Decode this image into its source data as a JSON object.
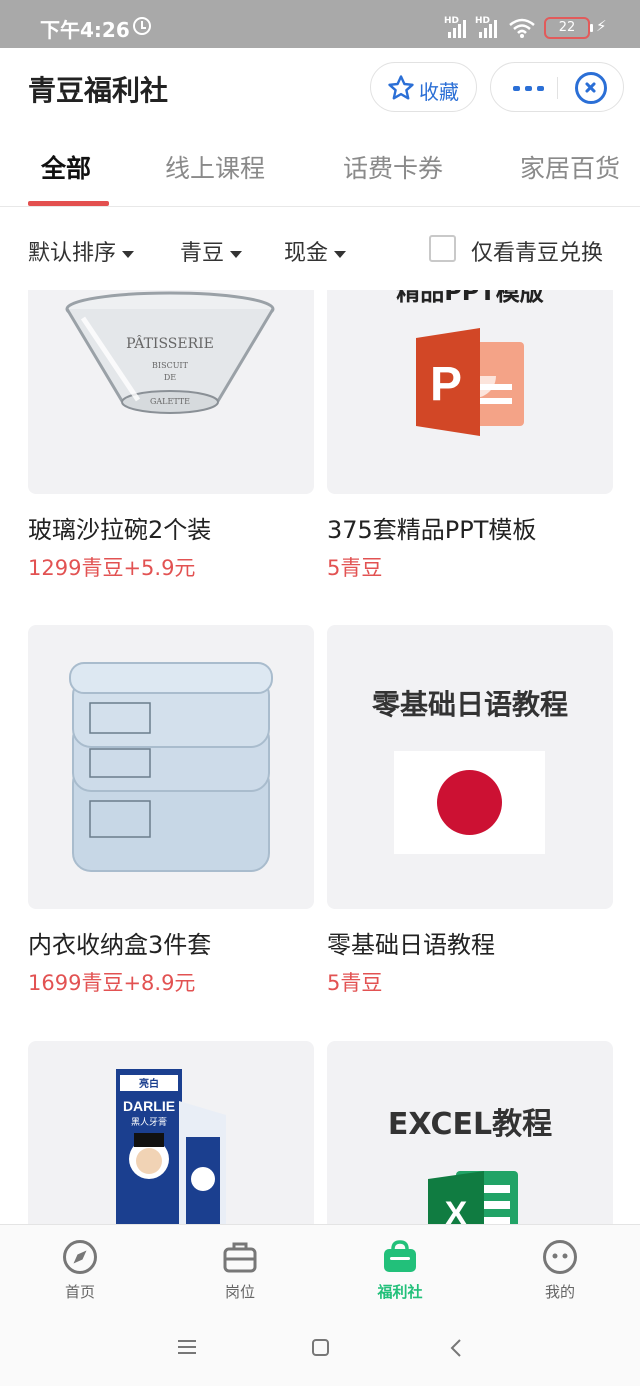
{
  "status_bar": {
    "time": "下午4:26",
    "signal_label_1": "HD",
    "signal_label_2": "HD",
    "battery": "22"
  },
  "header": {
    "title": "青豆福利社",
    "favorite_label": "收藏",
    "icons": [
      "star-icon",
      "more-icon",
      "close-mini-program-icon"
    ],
    "accent_color": "#2b6fd6"
  },
  "tabs": [
    {
      "label": "全部",
      "active": true
    },
    {
      "label": "线上课程",
      "active": false
    },
    {
      "label": "话费卡券",
      "active": false
    },
    {
      "label": "家居百货",
      "active": false
    }
  ],
  "filters": {
    "sort": "默认排序",
    "beans": "青豆",
    "cash": "现金",
    "only_beans_label": "仅看青豆兑换",
    "only_beans_checked": false
  },
  "products": [
    {
      "name": "玻璃沙拉碗2个装",
      "price": "1299青豆+5.9元",
      "image_text": [
        "PÂTISSERIE",
        "BISCUIT",
        "DE",
        "GALETTE"
      ]
    },
    {
      "name": "375套精品PPT模板",
      "price": "5青豆",
      "image_text": [
        "精品PPT模版",
        "P"
      ]
    },
    {
      "name": "内衣收纳盒3件套",
      "price": "1699青豆+8.9元"
    },
    {
      "name": "零基础日语教程",
      "price": "5青豆",
      "image_text": [
        "零基础日语教程"
      ]
    },
    {
      "image_text": [
        "DARLIE",
        "黑人牙膏",
        "亮白"
      ]
    },
    {
      "image_text": [
        "EXCEL教程",
        "X"
      ]
    }
  ],
  "price_color": "#e25252",
  "bottom_nav": [
    {
      "label": "首页",
      "icon": "compass-icon",
      "active": false
    },
    {
      "label": "岗位",
      "icon": "briefcase-icon",
      "active": false
    },
    {
      "label": "福利社",
      "icon": "gift-bag-icon",
      "active": true
    },
    {
      "label": "我的",
      "icon": "smiley-icon",
      "active": false
    }
  ],
  "nav_active_color": "#22c07a"
}
